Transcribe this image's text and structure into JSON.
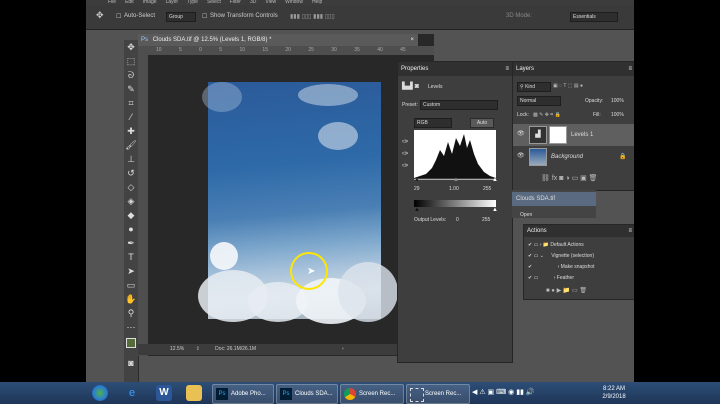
{
  "menu": [
    "File",
    "Edit",
    "Image",
    "Layer",
    "Type",
    "Select",
    "Filter",
    "3D",
    "View",
    "Window",
    "Help"
  ],
  "options": {
    "auto_select": "Auto-Select",
    "group": "Group",
    "show_transform": "Show Transform Controls",
    "mode_3d": "3D Mode:",
    "workspace": "Essentials"
  },
  "document": {
    "tab_title": "Clouds SDA.tif @ 12.5% (Levels 1, RGB/8) *",
    "ruler": [
      "10",
      "5",
      "0",
      "5",
      "10",
      "15",
      "20",
      "25",
      "30",
      "35",
      "40",
      "45",
      "50"
    ],
    "zoom": "12.5%",
    "doc_info": "Doc: 26.1M/26.1M"
  },
  "properties": {
    "title": "Properties",
    "panel_label": "Levels",
    "preset_label": "Preset:",
    "preset_value": "Custom",
    "channel": "RGB",
    "auto": "Auto",
    "input_low": "29",
    "input_mid": "1.00",
    "input_high": "255",
    "output_label": "Output Levels:",
    "output_low": "0",
    "output_high": "255"
  },
  "layers": {
    "title": "Layers",
    "kind": "Kind",
    "blend": "Normal",
    "opacity_label": "Opacity:",
    "opacity": "100%",
    "lock_label": "Lock:",
    "fill_label": "Fill:",
    "fill": "100%",
    "items": [
      {
        "name": "Levels 1"
      },
      {
        "name": "Background"
      }
    ]
  },
  "history": {
    "snapshot": "Clouds SDA.tif",
    "open": "Open"
  },
  "actions": {
    "title": "Actions",
    "items": [
      {
        "label": "Default Actions"
      },
      {
        "label": "Vignette (selection)"
      },
      {
        "label": "Make snapshot"
      },
      {
        "label": "Feather"
      }
    ]
  },
  "taskbar": {
    "items": [
      "Adobe Pho...",
      "Clouds SDA...",
      "Screen Rec...",
      "Screen Rec..."
    ],
    "time": "8:22 AM",
    "date": "2/9/2018"
  },
  "colors": {
    "accent": "#1c73d6",
    "ps_bg": "#535353",
    "panel": "#3e3e3e",
    "highlight_circle": "#ffe600"
  }
}
